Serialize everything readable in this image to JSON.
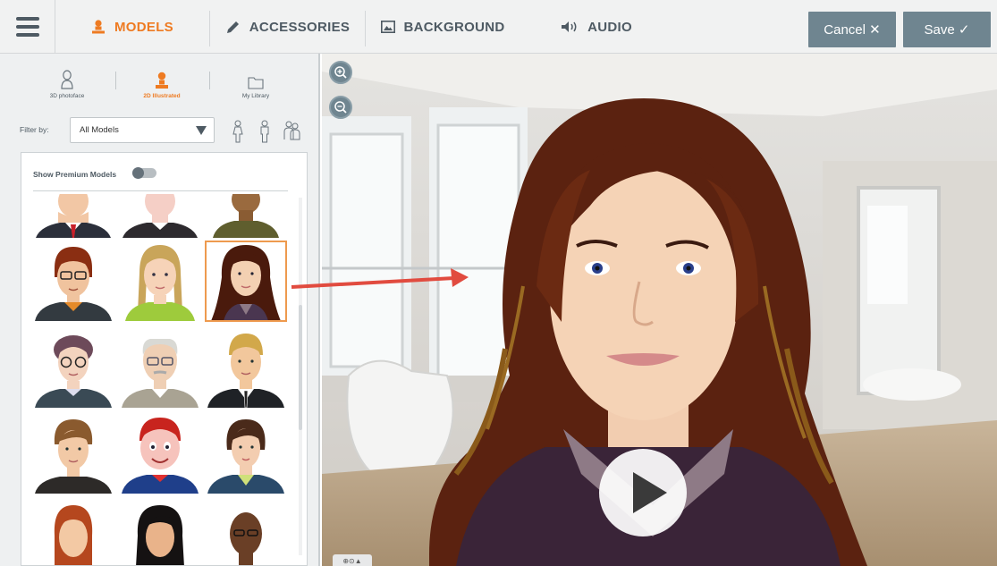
{
  "topbar": {
    "tabs": [
      {
        "label": "MODELS",
        "icon": "person-icon",
        "active": true
      },
      {
        "label": "ACCESSORIES",
        "icon": "pencil-icon",
        "active": false
      },
      {
        "label": "BACKGROUND",
        "icon": "image-icon",
        "active": false
      },
      {
        "label": "AUDIO",
        "icon": "speaker-icon",
        "active": false
      }
    ],
    "cancel_label": "Cancel ✕",
    "save_label": "Save ✓",
    "accent_color": "#ee7b22",
    "button_color": "#6f8590"
  },
  "sidebar": {
    "model_types": [
      {
        "label": "3D photoface",
        "icon": "person-outline-icon",
        "active": false
      },
      {
        "label": "2D Illustrated",
        "icon": "person-icon",
        "active": true
      },
      {
        "label": "My Library",
        "icon": "folder-icon",
        "active": false
      }
    ],
    "filter_label": "Filter by:",
    "filter_value": "All Models",
    "gender_filters": [
      "female-figure-icon",
      "male-figure-icon",
      "group-icon"
    ],
    "premium_label": "Show Premium Models",
    "premium_on": false,
    "models": [
      {
        "name": "man-red-tie"
      },
      {
        "name": "man-pale"
      },
      {
        "name": "woman-dark-skin"
      },
      {
        "name": "man-redhead-glasses"
      },
      {
        "name": "girl-blonde-braids"
      },
      {
        "name": "woman-long-brown-hair",
        "selected": true
      },
      {
        "name": "man-curly-glasses"
      },
      {
        "name": "old-man-glasses"
      },
      {
        "name": "man-blond-suit"
      },
      {
        "name": "man-brown-hair"
      },
      {
        "name": "boy-cartoon"
      },
      {
        "name": "woman-short-hair"
      },
      {
        "name": "woman-redhead"
      },
      {
        "name": "woman-black-hair"
      },
      {
        "name": "man-bald-dark"
      }
    ]
  },
  "stage": {
    "zoom_controls": [
      "zoom-in-icon",
      "zoom-out-icon"
    ],
    "mini_controls": "⊕⊙▲"
  }
}
